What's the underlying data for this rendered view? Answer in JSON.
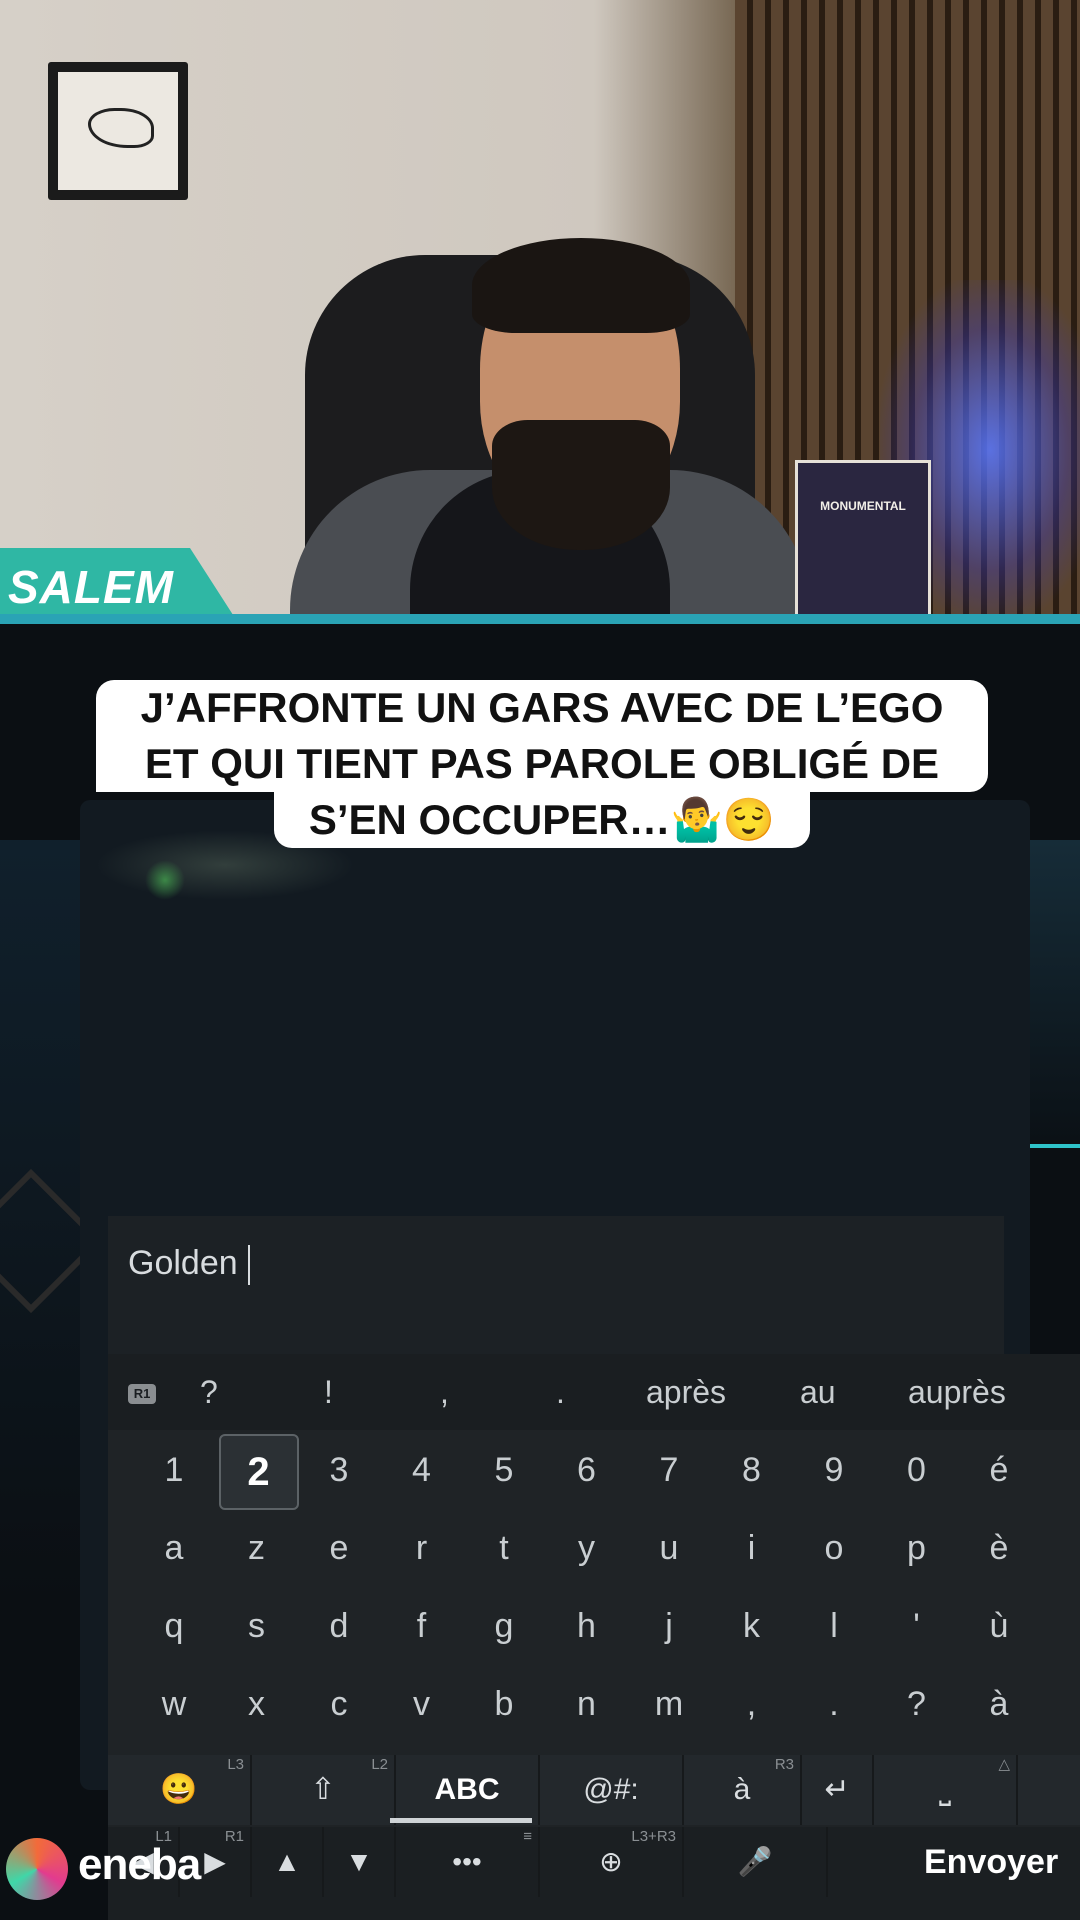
{
  "webcam": {
    "streamer_name": "SALEM",
    "poster_text": "MONUMENTAL"
  },
  "caption": {
    "line1": "J’AFFRONTE UN GARS AVEC DE L’EGO",
    "line2": "ET QUI TIENT PAS PAROLE OBLIGÉ DE",
    "line3": "S’EN OCCUPER…🤷‍♂️😌"
  },
  "input": {
    "value": "Golden"
  },
  "keyboard": {
    "suggest_badge": "R1",
    "suggestions": [
      "?",
      "!",
      ",",
      ".",
      "après",
      "au",
      "auprès"
    ],
    "rows": [
      [
        "1",
        "2",
        "3",
        "4",
        "5",
        "6",
        "7",
        "8",
        "9",
        "0",
        "é"
      ],
      [
        "a",
        "z",
        "e",
        "r",
        "t",
        "y",
        "u",
        "i",
        "o",
        "p",
        "è"
      ],
      [
        "q",
        "s",
        "d",
        "f",
        "g",
        "h",
        "j",
        "k",
        "l",
        "'",
        "ù"
      ],
      [
        "w",
        "x",
        "c",
        "v",
        "b",
        "n",
        "m",
        ",",
        ".",
        "?",
        "à"
      ]
    ],
    "selected_key": "2",
    "fn_row": [
      {
        "name": "emoji-button",
        "label": "😀",
        "tag": "L3"
      },
      {
        "name": "shift-button",
        "label": "⇧",
        "tag": "L2"
      },
      {
        "name": "abc-mode-button",
        "label": "ABC",
        "tag": ""
      },
      {
        "name": "symbols-button",
        "label": "@#:",
        "tag": ""
      },
      {
        "name": "accents-button",
        "label": "à",
        "tag": "R3"
      },
      {
        "name": "enter-button",
        "label": "↵",
        "tag": ""
      },
      {
        "name": "space-button",
        "label": "⎵",
        "tag": "△"
      }
    ],
    "bottom_row": [
      {
        "name": "left-button",
        "label": "◀",
        "tag": "L1"
      },
      {
        "name": "right-button",
        "label": "▶",
        "tag": "R1"
      },
      {
        "name": "up-button",
        "label": "▲",
        "tag": ""
      },
      {
        "name": "down-button",
        "label": "▼",
        "tag": ""
      },
      {
        "name": "more-button",
        "label": "•••",
        "tag": "≡"
      },
      {
        "name": "pointer-button",
        "label": "⊕",
        "tag": "L3+R3"
      },
      {
        "name": "mic-button",
        "label": "🎤",
        "tag": ""
      }
    ],
    "send_label": "Envoyer"
  },
  "brand": {
    "logo_text": "eneba"
  }
}
